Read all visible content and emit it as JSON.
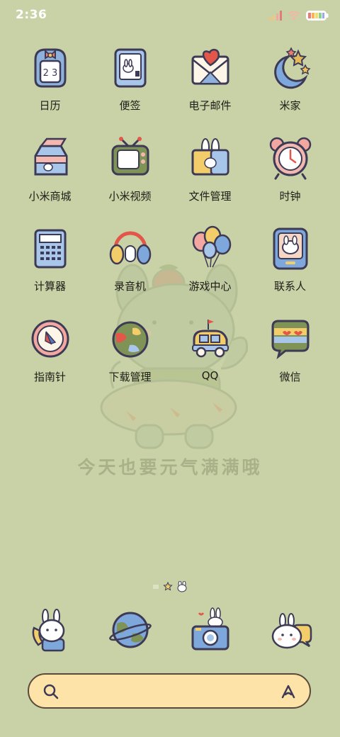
{
  "status_bar": {
    "time": "2:36",
    "icons": [
      "signal-icon",
      "wifi-icon",
      "battery-icon"
    ]
  },
  "wallpaper": {
    "caption": "今天也要元气满满哦",
    "background_color": "#c8d2a6"
  },
  "apps": [
    {
      "label": "日历",
      "icon": "calendar-icon"
    },
    {
      "label": "便签",
      "icon": "notes-icon"
    },
    {
      "label": "电子邮件",
      "icon": "email-icon"
    },
    {
      "label": "米家",
      "icon": "mi-home-icon"
    },
    {
      "label": "小米商城",
      "icon": "mi-store-icon"
    },
    {
      "label": "小米视频",
      "icon": "mi-video-icon"
    },
    {
      "label": "文件管理",
      "icon": "file-manager-icon"
    },
    {
      "label": "时钟",
      "icon": "clock-icon"
    },
    {
      "label": "计算器",
      "icon": "calculator-icon"
    },
    {
      "label": "录音机",
      "icon": "recorder-icon"
    },
    {
      "label": "游戏中心",
      "icon": "game-center-icon"
    },
    {
      "label": "联系人",
      "icon": "contacts-icon"
    },
    {
      "label": "指南针",
      "icon": "compass-icon"
    },
    {
      "label": "下载管理",
      "icon": "download-manager-icon"
    },
    {
      "label": "QQ",
      "icon": "qq-icon"
    },
    {
      "label": "微信",
      "icon": "wechat-icon"
    }
  ],
  "page_indicator": {
    "pages": 3,
    "current": 2
  },
  "dock": [
    {
      "icon": "phone-icon"
    },
    {
      "icon": "browser-icon"
    },
    {
      "icon": "camera-icon"
    },
    {
      "icon": "messages-icon"
    }
  ],
  "search": {
    "placeholder": ""
  }
}
